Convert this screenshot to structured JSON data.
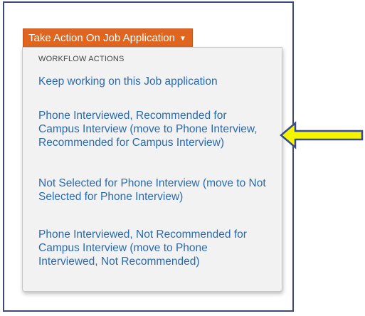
{
  "button": {
    "label": "Take Action On Job Application",
    "caret": "▼"
  },
  "menu": {
    "header": "WORKFLOW ACTIONS",
    "items": [
      {
        "label": "Keep working on this Job application"
      },
      {
        "label": "Phone Interviewed, Recommended for Campus Interview (move to Phone Interview, Recommended for Campus Interview)"
      },
      {
        "label": "Not Selected for Phone Interview (move to Not Selected for Phone Interview)"
      },
      {
        "label": "Phone Interviewed, Not Recommended for Campus Interview (move to Phone Interviewed, Not Recommended)"
      }
    ]
  },
  "colors": {
    "button": "#e0651f",
    "link": "#2a6ab0",
    "arrow_fill": "#f5f500",
    "arrow_stroke": "#3a4a8a",
    "frame_border": "#3b4a7a"
  },
  "icons": {
    "pointer": "arrow-left-icon"
  }
}
